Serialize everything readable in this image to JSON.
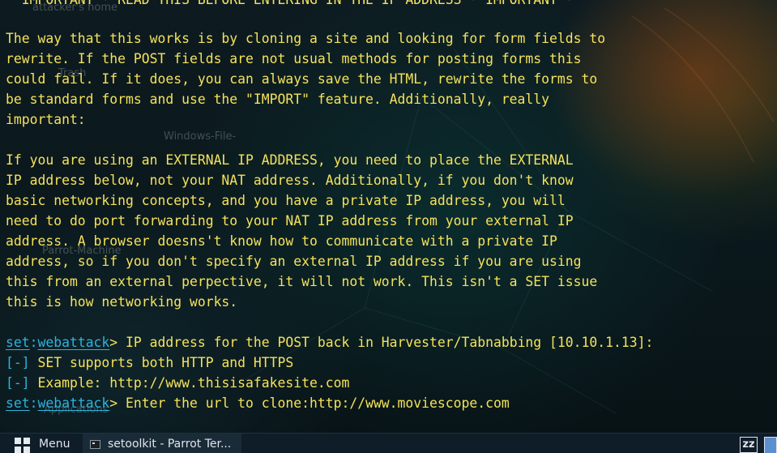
{
  "desktop": {
    "labels": [
      "attacker's home",
      "Trash",
      "Windows-File-",
      "Parrot-Machine",
      "Applications"
    ]
  },
  "terminal": {
    "lines": [
      {
        "kind": "text",
        "text": "  IMPORTANT * READ THIS BEFORE ENTERING IN THE IP ADDRESS * IMPORTANT *"
      },
      {
        "kind": "blank",
        "text": ""
      },
      {
        "kind": "text",
        "text": "The way that this works is by cloning a site and looking for form fields to"
      },
      {
        "kind": "text",
        "text": "rewrite. If the POST fields are not usual methods for posting forms this"
      },
      {
        "kind": "text",
        "text": "could fail. If it does, you can always save the HTML, rewrite the forms to"
      },
      {
        "kind": "text",
        "text": "be standard forms and use the \"IMPORT\" feature. Additionally, really"
      },
      {
        "kind": "text",
        "text": "important:"
      },
      {
        "kind": "blank",
        "text": ""
      },
      {
        "kind": "text",
        "text": "If you are using an EXTERNAL IP ADDRESS, you need to place the EXTERNAL"
      },
      {
        "kind": "text",
        "text": "IP address below, not your NAT address. Additionally, if you don't know"
      },
      {
        "kind": "text",
        "text": "basic networking concepts, and you have a private IP address, you will"
      },
      {
        "kind": "text",
        "text": "need to do port forwarding to your NAT IP address from your external IP"
      },
      {
        "kind": "text",
        "text": "address. A browser doesns't know how to communicate with a private IP"
      },
      {
        "kind": "text",
        "text": "address, so if you don't specify an external IP address if you are using"
      },
      {
        "kind": "text",
        "text": "this from an external perpective, it will not work. This isn't a SET issue"
      },
      {
        "kind": "text",
        "text": "this is how networking works."
      },
      {
        "kind": "blank",
        "text": ""
      },
      {
        "kind": "prompt",
        "set": "set",
        "colon": ":",
        "module": "webattack",
        "text": "> IP address for the POST back in Harvester/Tabnabbing [10.10.1.13]:"
      },
      {
        "kind": "info",
        "tag": "[-]",
        "text": " SET supports both HTTP and HTTPS"
      },
      {
        "kind": "info",
        "tag": "[-]",
        "text": " Example: http://www.thisisafakesite.com"
      },
      {
        "kind": "prompt",
        "set": "set",
        "colon": ":",
        "module": "webattack",
        "text": "> Enter the url to clone:http://www.moviescope.com"
      }
    ]
  },
  "taskbar": {
    "menu_label": "Menu",
    "task_label": "setoolkit - Parrot Ter...",
    "tray_zz": "zz"
  },
  "colors": {
    "terminal_text": "#f5e25a",
    "prompt": "#2db3de",
    "taskbar_bg": "#0f1d29"
  },
  "icons": [
    "menu-grid-icon",
    "terminal-icon",
    "zz-tray-icon",
    "workspace-icon"
  ]
}
